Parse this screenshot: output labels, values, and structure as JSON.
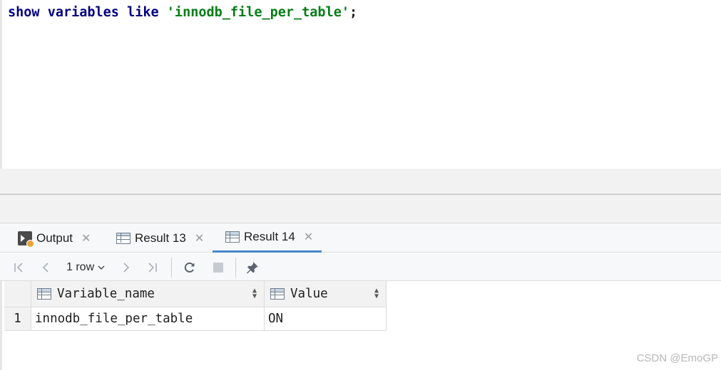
{
  "editor": {
    "keyword_show": "show",
    "keyword_variables": "variables",
    "keyword_like": "like",
    "string_literal": "'innodb_file_per_table'",
    "terminator": ";"
  },
  "tabs": [
    {
      "label": "Output",
      "icon": "console-output-icon",
      "active": false
    },
    {
      "label": "Result 13",
      "icon": "table-icon",
      "active": false
    },
    {
      "label": "Result 14",
      "icon": "table-icon",
      "active": true
    }
  ],
  "toolbar": {
    "rows_label": "1 row",
    "icons": [
      "first-page-icon",
      "previous-page-icon",
      "next-page-icon",
      "last-page-icon",
      "refresh-icon",
      "stop-icon",
      "pin-icon"
    ]
  },
  "grid": {
    "columns": [
      "Variable_name",
      "Value"
    ],
    "rows": [
      {
        "num": "1",
        "cells": [
          "innodb_file_per_table",
          "ON"
        ]
      }
    ]
  },
  "watermark": "CSDN @EmoGP",
  "colors": {
    "keyword": "#000080",
    "string": "#067d17",
    "active_tab_underline": "#4a86c8"
  }
}
